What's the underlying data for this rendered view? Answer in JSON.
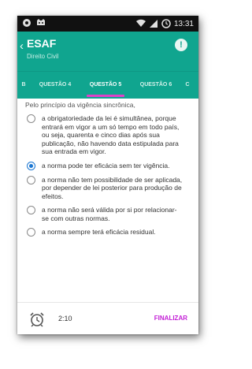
{
  "status_bar": {
    "time": "13:31"
  },
  "app_bar": {
    "back": "‹",
    "title": "ESAF",
    "subtitle": "Direito Civil",
    "info": "!"
  },
  "tabs": [
    {
      "label": "B"
    },
    {
      "label": "QUESTÃO 4"
    },
    {
      "label": "QUESTÃO 5"
    },
    {
      "label": "QUESTÃO 6"
    },
    {
      "label": "C"
    }
  ],
  "active_tab": "QUESTÃO 5",
  "question": {
    "text": "Pelo princípio da vigência sincrônica,"
  },
  "options": [
    {
      "text": "a obrigatoriedade da lei é simultânea, porque entrará em vigor a um só tempo em todo país, ou seja, quarenta e cinco dias após sua publicação, não havendo data estipulada para sua entrada em vigor.",
      "selected": false
    },
    {
      "text": "a norma pode ter eficácia sem ter vigência.",
      "selected": true
    },
    {
      "text": "a norma não tem possibilidade de ser aplicada, por depender de lei posterior para produção de efeitos.",
      "selected": false
    },
    {
      "text": "a norma não será válida por si por relacionar-se com outras normas.",
      "selected": false
    },
    {
      "text": "a norma sempre terá eficácia residual.",
      "selected": false
    }
  ],
  "bottom_bar": {
    "timer": "2:10",
    "finish_label": "FINALIZAR"
  },
  "colors": {
    "primary": "#10a58f",
    "accent": "#c31fd6",
    "radio_selected": "#1976d2"
  }
}
